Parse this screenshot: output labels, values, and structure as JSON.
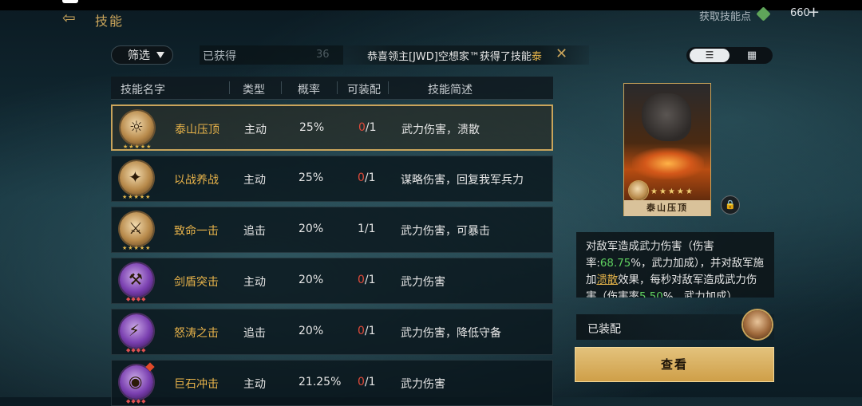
{
  "header": {
    "title": "技能",
    "skill_points_label": "获取技能点",
    "skill_points_value": "660",
    "back_icon": "back-arrow-icon"
  },
  "toolbar": {
    "filter_label": "筛选",
    "obtained_label": "已获得",
    "obtained_count": "36",
    "ticker_prefix": "恭喜领主[JWD]空想家™获得了技能",
    "ticker_skill": "泰",
    "view_list_icon": "list-view-icon",
    "view_grid_icon": "grid-view-icon"
  },
  "table": {
    "headers": [
      "技能名字",
      "类型",
      "概率",
      "可装配",
      "技能简述"
    ],
    "rows": [
      {
        "name": "泰山压顶",
        "type": "主动",
        "rate": "25%",
        "equip_used": "0",
        "equip_max": "/1",
        "desc": "武力伤害，溃散",
        "quality": "gold",
        "stars": "★★★★★",
        "selected": true
      },
      {
        "name": "以战养战",
        "type": "主动",
        "rate": "25%",
        "equip_used": "0",
        "equip_max": "/1",
        "desc": "谋略伤害，回复我军兵力",
        "quality": "gold",
        "stars": "★★★★★",
        "selected": false
      },
      {
        "name": "致命一击",
        "type": "追击",
        "rate": "20%",
        "equip_used": "1",
        "equip_max": "/1",
        "desc": "武力伤害，可暴击",
        "quality": "gold",
        "stars": "★★★★★",
        "selected": false
      },
      {
        "name": "剑盾突击",
        "type": "主动",
        "rate": "20%",
        "equip_used": "0",
        "equip_max": "/1",
        "desc": "武力伤害",
        "quality": "purple",
        "stars": "◆◆◆◆",
        "selected": false
      },
      {
        "name": "怒涛之击",
        "type": "追击",
        "rate": "20%",
        "equip_used": "0",
        "equip_max": "/1",
        "desc": "武力伤害，降低守备",
        "quality": "purple",
        "stars": "◆◆◆◆",
        "selected": false
      },
      {
        "name": "巨石冲击",
        "type": "主动",
        "rate": "21.25%",
        "equip_used": "0",
        "equip_max": "/1",
        "desc": "武力伤害",
        "quality": "purple",
        "stars": "◆◆◆◆",
        "selected": false
      }
    ]
  },
  "detail": {
    "card_name": "泰山压顶",
    "card_stars": "★★★★★",
    "description_parts": {
      "p1": "对敌军造成武力伤害（伤害率:",
      "v1": "68.75",
      "p2": "%，武力加成），并对敌军施加",
      "link": "溃散",
      "p3": "效果，每秒对敌军造成武力伤害（伤害率",
      "v2": "5.50",
      "p4": "%，武力加成）"
    },
    "equipped_label": "已装配",
    "view_button": "查看"
  }
}
